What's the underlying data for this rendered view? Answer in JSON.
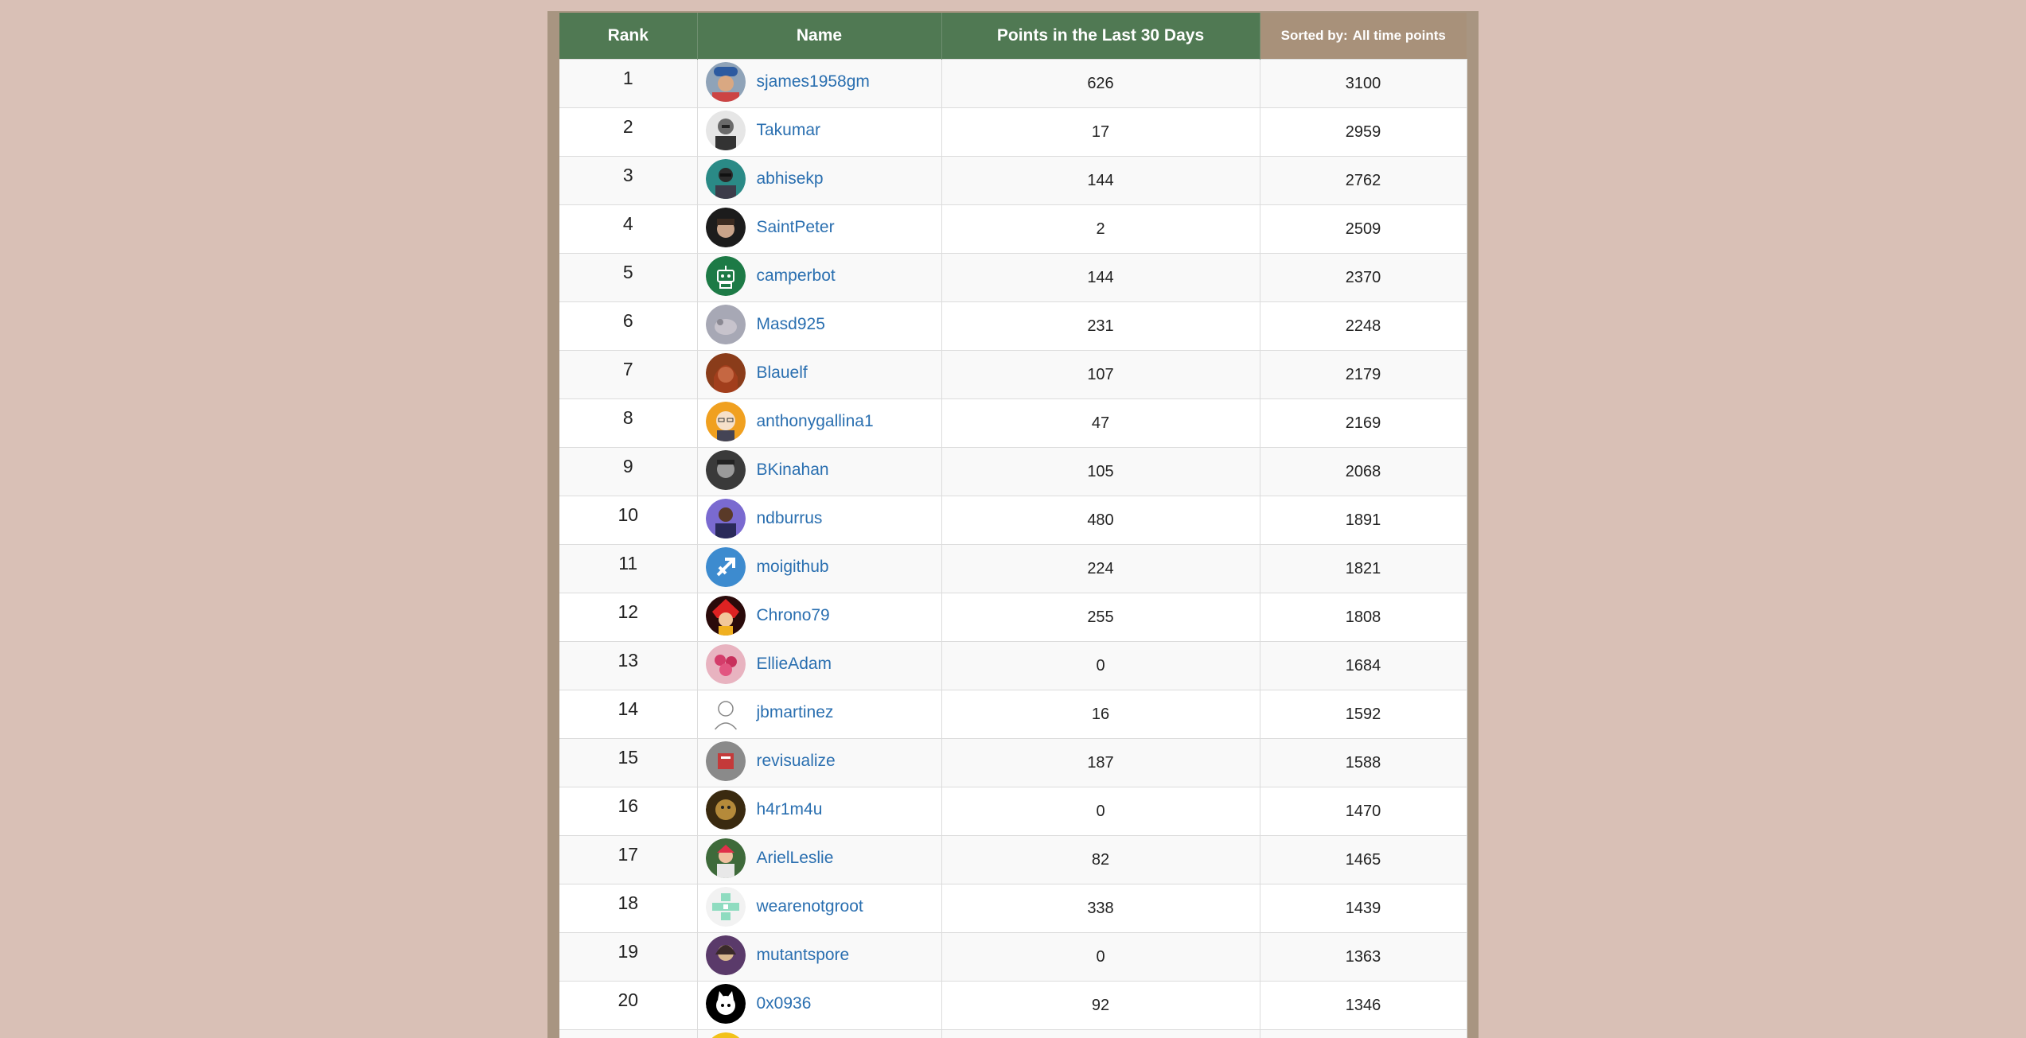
{
  "headers": {
    "rank": "Rank",
    "name": "Name",
    "recent": "Points in the Last 30 Days",
    "sorted_label": "Sorted by:",
    "sorted_value": "All time points"
  },
  "colors": {
    "header_green": "#507953",
    "header_tan": "#a8917a",
    "page_bg": "#d9c0b6",
    "link": "#2a6fb0"
  },
  "rows": [
    {
      "rank": "1",
      "name": "sjames1958gm",
      "recent": "626",
      "alltime": "3100",
      "avatar": "photo-blue-cap"
    },
    {
      "rank": "2",
      "name": "Takumar",
      "recent": "17",
      "alltime": "2959",
      "avatar": "photo-bw-man"
    },
    {
      "rank": "3",
      "name": "abhisekp",
      "recent": "144",
      "alltime": "2762",
      "avatar": "photo-teal"
    },
    {
      "rank": "4",
      "name": "SaintPeter",
      "recent": "2",
      "alltime": "2509",
      "avatar": "photo-dark"
    },
    {
      "rank": "5",
      "name": "camperbot",
      "recent": "144",
      "alltime": "2370",
      "avatar": "robot-green"
    },
    {
      "rank": "6",
      "name": "Masd925",
      "recent": "231",
      "alltime": "2248",
      "avatar": "photo-grey"
    },
    {
      "rank": "7",
      "name": "Blauelf",
      "recent": "107",
      "alltime": "2179",
      "avatar": "photo-redhair"
    },
    {
      "rank": "8",
      "name": "anthonygallina1",
      "recent": "47",
      "alltime": "2169",
      "avatar": "cartoon-orange"
    },
    {
      "rank": "9",
      "name": "BKinahan",
      "recent": "105",
      "alltime": "2068",
      "avatar": "photo-bw-face"
    },
    {
      "rank": "10",
      "name": "ndburrus",
      "recent": "480",
      "alltime": "1891",
      "avatar": "photo-purple"
    },
    {
      "rank": "11",
      "name": "moigithub",
      "recent": "224",
      "alltime": "1821",
      "avatar": "arrow-blue"
    },
    {
      "rank": "12",
      "name": "Chrono79",
      "recent": "255",
      "alltime": "1808",
      "avatar": "anime-red"
    },
    {
      "rank": "13",
      "name": "EllieAdam",
      "recent": "0",
      "alltime": "1684",
      "avatar": "flowers-pink"
    },
    {
      "rank": "14",
      "name": "jbmartinez",
      "recent": "16",
      "alltime": "1592",
      "avatar": "sketch"
    },
    {
      "rank": "15",
      "name": "revisualize",
      "recent": "187",
      "alltime": "1588",
      "avatar": "photo-book"
    },
    {
      "rank": "16",
      "name": "h4r1m4u",
      "recent": "0",
      "alltime": "1470",
      "avatar": "photo-brown"
    },
    {
      "rank": "17",
      "name": "ArielLeslie",
      "recent": "82",
      "alltime": "1465",
      "avatar": "photo-colorful"
    },
    {
      "rank": "18",
      "name": "wearenotgroot",
      "recent": "338",
      "alltime": "1439",
      "avatar": "identicon-mint"
    },
    {
      "rank": "19",
      "name": "mutantspore",
      "recent": "0",
      "alltime": "1363",
      "avatar": "photo-violet"
    },
    {
      "rank": "20",
      "name": "0x0936",
      "recent": "92",
      "alltime": "1346",
      "avatar": "cat-black"
    },
    {
      "rank": "",
      "name": "",
      "recent": "",
      "alltime": "",
      "avatar": "yellow"
    }
  ]
}
